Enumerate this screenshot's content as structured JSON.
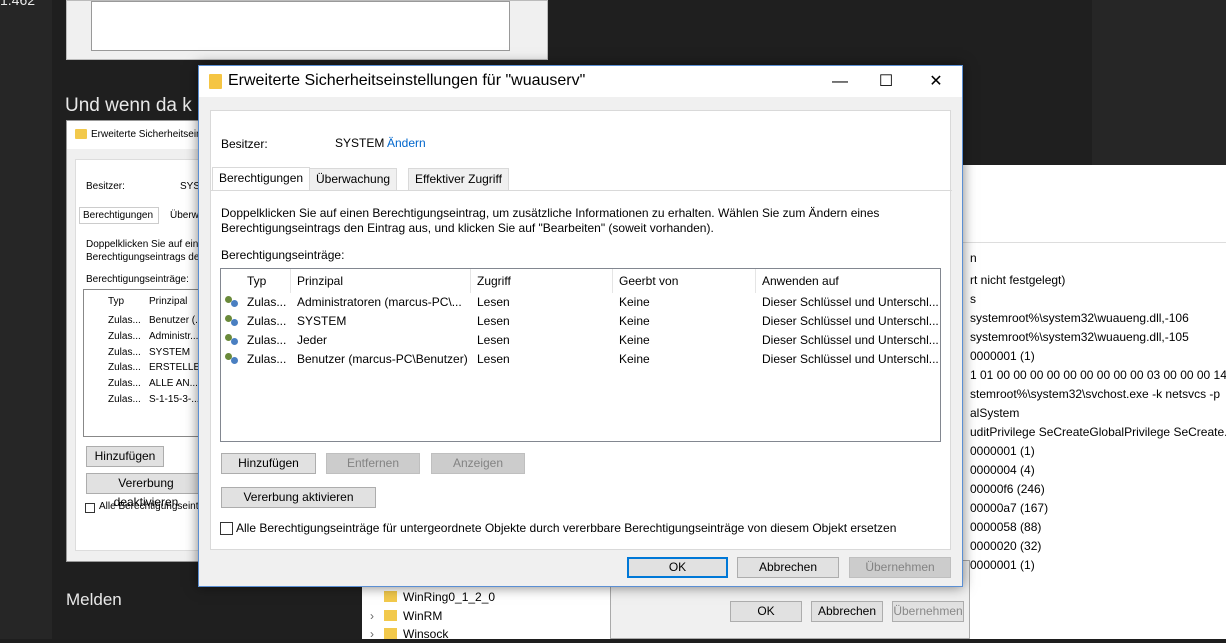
{
  "background": {
    "corner_text": "1.462",
    "heading_text": "Und wenn da k",
    "footer_text": "Melden",
    "left_dialog": {
      "title": "Erweiterte Sicherheitsein",
      "owner_label": "Besitzer:",
      "owner_value": "SYS",
      "tabs": [
        "Berechtigungen",
        "Überw"
      ],
      "description": [
        "Doppelklicken Sie auf ein",
        "Berechtigungseintrags de"
      ],
      "entries_label": "Berechtigungseinträge:",
      "columns": [
        "Typ",
        "Prinzipal"
      ],
      "rows": [
        {
          "type": "Zulas...",
          "principal": "Benutzer (..."
        },
        {
          "type": "Zulas...",
          "principal": "Administr..."
        },
        {
          "type": "Zulas...",
          "principal": "SYSTEM"
        },
        {
          "type": "Zulas...",
          "principal": "ERSTELLE..."
        },
        {
          "type": "Zulas...",
          "principal": "ALLE AN..."
        },
        {
          "type": "Zulas...",
          "principal": "S-1-15-3-..."
        }
      ],
      "add_button": "Hinzufügen",
      "inherit_button": "Vererbung deaktivieren",
      "replace_checkbox": "Alle Berechtigungseint"
    },
    "registry_values": [
      "n",
      "rt nicht festgelegt)",
      "s",
      "systemroot%\\system32\\wuaueng.dll,-106",
      "systemroot%\\system32\\wuaueng.dll,-105",
      "0000001 (1)",
      "1 01 00 00 00 00 00 00 00 00 00 03 00 00 00 14 00...",
      "stemroot%\\system32\\svchost.exe -k netsvcs -p",
      "alSystem",
      "uditPrivilege SeCreateGlobalPrivilege SeCreate...",
      "0000001 (1)",
      "0000004 (4)",
      "00000f6 (246)",
      "00000a7 (167)",
      "0000058 (88)",
      "0000020 (32)",
      "0000001 (1)"
    ],
    "tree_items": [
      "WinRing0_1_2_0",
      "WinRM",
      "Winsock"
    ],
    "bottom_dialog": {
      "ok": "OK",
      "cancel": "Abbrechen",
      "apply": "Übernehmen"
    }
  },
  "dialog": {
    "title": "Erweiterte Sicherheitseinstellungen für \"wuauserv\"",
    "minimize": "—",
    "maximize": "☐",
    "close": "✕",
    "owner_label": "Besitzer:",
    "owner_value": "SYSTEM",
    "owner_change": "Ändern",
    "tabs": [
      "Berechtigungen",
      "Überwachung",
      "Effektiver Zugriff"
    ],
    "description": "Doppelklicken Sie auf einen Berechtigungseintrag, um zusätzliche Informationen zu erhalten. Wählen Sie zum Ändern eines Berechtigungseintrags den Eintrag aus, und klicken Sie auf \"Bearbeiten\" (soweit vorhanden).",
    "entries_label": "Berechtigungseinträge:",
    "columns": [
      "Typ",
      "Prinzipal",
      "Zugriff",
      "Geerbt von",
      "Anwenden auf"
    ],
    "rows": [
      {
        "type": "Zulas...",
        "principal": "Administratoren (marcus-PC\\...",
        "access": "Lesen",
        "inherited": "Keine",
        "applies": "Dieser Schlüssel und Unterschl..."
      },
      {
        "type": "Zulas...",
        "principal": "SYSTEM",
        "access": "Lesen",
        "inherited": "Keine",
        "applies": "Dieser Schlüssel und Unterschl..."
      },
      {
        "type": "Zulas...",
        "principal": "Jeder",
        "access": "Lesen",
        "inherited": "Keine",
        "applies": "Dieser Schlüssel und Unterschl..."
      },
      {
        "type": "Zulas...",
        "principal": "Benutzer (marcus-PC\\Benutzer)",
        "access": "Lesen",
        "inherited": "Keine",
        "applies": "Dieser Schlüssel und Unterschl..."
      }
    ],
    "buttons": {
      "add": "Hinzufügen",
      "remove": "Entfernen",
      "view": "Anzeigen",
      "enable_inheritance": "Vererbung aktivieren",
      "ok": "OK",
      "cancel": "Abbrechen",
      "apply": "Übernehmen"
    },
    "replace_checkbox_label": "Alle Berechtigungseinträge für untergeordnete Objekte durch vererbbare Berechtigungseinträge von diesem Objekt ersetzen"
  }
}
